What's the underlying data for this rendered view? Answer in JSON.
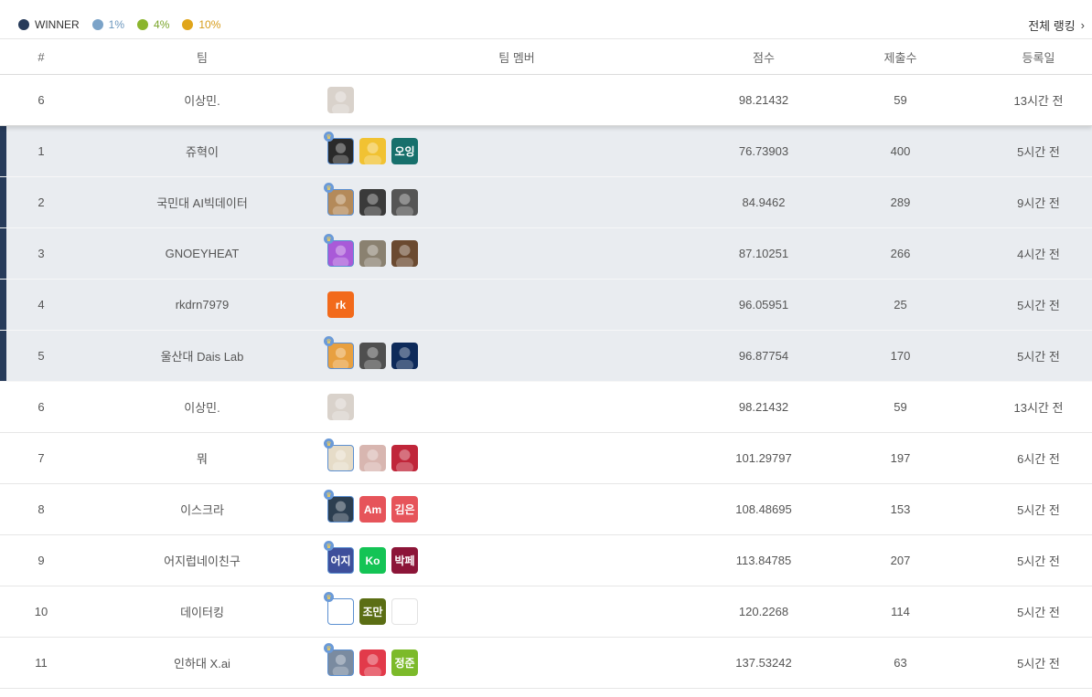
{
  "legend": [
    {
      "label": "WINNER",
      "color": "#273b5a",
      "text_color": "#333333"
    },
    {
      "label": "1%",
      "color": "#7ba3c8",
      "text_color": "#6b96bd"
    },
    {
      "label": "4%",
      "color": "#8bb52d",
      "text_color": "#7aa52a"
    },
    {
      "label": "10%",
      "color": "#e0a51b",
      "text_color": "#d79c1a"
    }
  ],
  "overall_ranking_label": "전체 랭킹",
  "columns": {
    "rank": "#",
    "team": "팀",
    "members": "팀 멤버",
    "score": "점수",
    "submissions": "제출수",
    "registered": "등록일"
  },
  "rows": [
    {
      "rank": "6",
      "team": "이상민.",
      "score": "98.21432",
      "submissions": "59",
      "registered": "13시간 전",
      "style": "mine",
      "members": [
        {
          "type": "photo",
          "icon": "person-photo",
          "bg": "#d9d2cb"
        }
      ]
    },
    {
      "rank": "1",
      "team": "쥬혁이",
      "score": "76.73903",
      "submissions": "400",
      "registered": "5시간 전",
      "style": "winner",
      "members": [
        {
          "type": "photo",
          "leader": true,
          "icon": "person-photo",
          "bg": "#2a2a2a"
        },
        {
          "type": "photo",
          "icon": "character-photo",
          "bg": "#f1c232"
        },
        {
          "type": "text",
          "text": "오잉",
          "bg": "#17706c"
        }
      ]
    },
    {
      "rank": "2",
      "team": "국민대 AI빅데이터",
      "score": "84.9462",
      "submissions": "289",
      "registered": "9시간 전",
      "style": "winner",
      "members": [
        {
          "type": "photo",
          "leader": true,
          "icon": "bear-photo",
          "bg": "#b48a5a"
        },
        {
          "type": "photo",
          "icon": "person-photo",
          "bg": "#3a3a3a"
        },
        {
          "type": "photo",
          "icon": "person-photo",
          "bg": "#555555"
        }
      ]
    },
    {
      "rank": "3",
      "team": "GNOEYHEAT",
      "score": "87.10251",
      "submissions": "266",
      "registered": "4시간 전",
      "style": "winner",
      "members": [
        {
          "type": "photo",
          "leader": true,
          "icon": "pirate-photo",
          "bg": "#a95ad8"
        },
        {
          "type": "photo",
          "icon": "cat-photo",
          "bg": "#8a8170"
        },
        {
          "type": "photo",
          "icon": "scene-photo",
          "bg": "#6b4a30"
        }
      ]
    },
    {
      "rank": "4",
      "team": "rkdrn7979",
      "score": "96.05951",
      "submissions": "25",
      "registered": "5시간 전",
      "style": "winner",
      "members": [
        {
          "type": "text",
          "text": "rk",
          "bg": "#f26a1b"
        }
      ]
    },
    {
      "rank": "5",
      "team": "울산대 Dais Lab",
      "score": "96.87754",
      "submissions": "170",
      "registered": "5시간 전",
      "style": "winner",
      "members": [
        {
          "type": "photo",
          "leader": true,
          "icon": "character-photo",
          "bg": "#e8a040"
        },
        {
          "type": "photo",
          "icon": "person-photo",
          "bg": "#4f4f4f"
        },
        {
          "type": "photo",
          "icon": "space-photo",
          "bg": "#0d2a5a"
        }
      ]
    },
    {
      "rank": "6",
      "team": "이상민.",
      "score": "98.21432",
      "submissions": "59",
      "registered": "13시간 전",
      "style": "normal",
      "members": [
        {
          "type": "photo",
          "icon": "person-photo",
          "bg": "#d9d2cb"
        }
      ]
    },
    {
      "rank": "7",
      "team": "뭐",
      "score": "101.29797",
      "submissions": "197",
      "registered": "6시간 전",
      "style": "normal",
      "members": [
        {
          "type": "photo",
          "leader": true,
          "icon": "potato-photo",
          "bg": "#e6dcc8"
        },
        {
          "type": "photo",
          "icon": "person-photo",
          "bg": "#d8b6b0"
        },
        {
          "type": "photo",
          "icon": "person-photo",
          "bg": "#c0263a"
        }
      ]
    },
    {
      "rank": "8",
      "team": "이스크라",
      "score": "108.48695",
      "submissions": "153",
      "registered": "5시간 전",
      "style": "normal",
      "members": [
        {
          "type": "photo",
          "leader": true,
          "icon": "person-photo",
          "bg": "#2c3e50"
        },
        {
          "type": "text",
          "text": "Am",
          "bg": "#e6545a"
        },
        {
          "type": "text",
          "text": "김은",
          "bg": "#e6545a"
        }
      ]
    },
    {
      "rank": "9",
      "team": "어지럽네이친구",
      "score": "113.84785",
      "submissions": "207",
      "registered": "5시간 전",
      "style": "normal",
      "members": [
        {
          "type": "text",
          "leader": true,
          "text": "어지",
          "bg": "#3e4f9b"
        },
        {
          "type": "text",
          "text": "Ko",
          "bg": "#14c455"
        },
        {
          "type": "text",
          "text": "박페",
          "bg": "#8c1538"
        }
      ]
    },
    {
      "rank": "10",
      "team": "데이터킹",
      "score": "120.2268",
      "submissions": "114",
      "registered": "5시간 전",
      "style": "normal",
      "members": [
        {
          "type": "text",
          "leader": true,
          "text": "",
          "bg": "#ffffff"
        },
        {
          "type": "text",
          "text": "조만",
          "bg": "#5b6e14"
        },
        {
          "type": "text",
          "text": "",
          "bg": "#ffffff",
          "bordered": true
        }
      ]
    },
    {
      "rank": "11",
      "team": "인하대 X.ai",
      "score": "137.53242",
      "submissions": "63",
      "registered": "5시간 전",
      "style": "normal",
      "members": [
        {
          "type": "photo",
          "leader": true,
          "icon": "person-photo",
          "bg": "#7a8ba0"
        },
        {
          "type": "photo",
          "icon": "flower-photo",
          "bg": "#e23a4a"
        },
        {
          "type": "text",
          "text": "정준",
          "bg": "#7cba2a"
        }
      ]
    }
  ]
}
